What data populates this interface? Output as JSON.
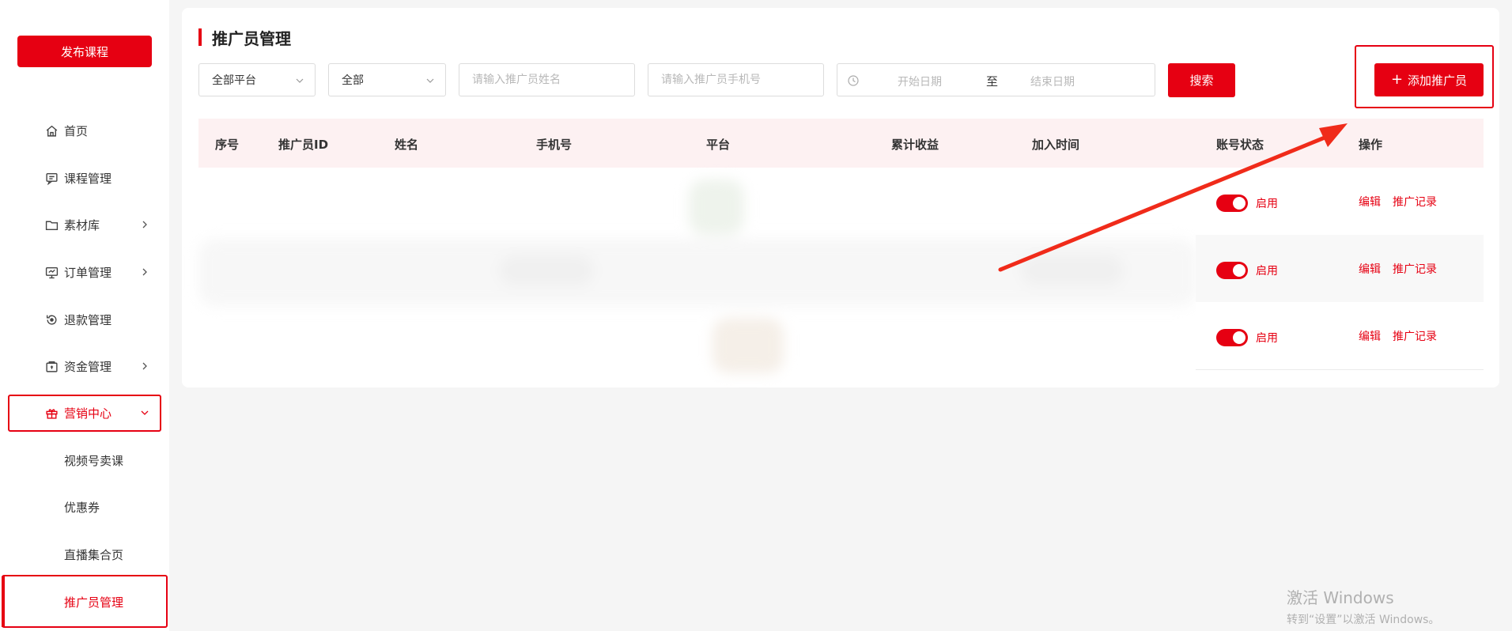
{
  "sidebar": {
    "publish_label": "发布课程",
    "items": [
      {
        "label": "首页",
        "icon": "home-icon"
      },
      {
        "label": "课程管理",
        "icon": "chat-icon"
      },
      {
        "label": "素材库",
        "icon": "folder-icon"
      },
      {
        "label": "订单管理",
        "icon": "monitor-icon"
      },
      {
        "label": "退款管理",
        "icon": "refund-icon"
      },
      {
        "label": "资金管理",
        "icon": "wallet-icon"
      },
      {
        "label": "营销中心",
        "icon": "gift-icon"
      }
    ],
    "sub_items": [
      {
        "label": "视频号卖课"
      },
      {
        "label": "优惠券"
      },
      {
        "label": "直播集合页"
      },
      {
        "label": "推广员管理"
      }
    ]
  },
  "page": {
    "title": "推广员管理"
  },
  "filters": {
    "platform": "全部平台",
    "scope": "全部",
    "name_placeholder": "请输入推广员姓名",
    "phone_placeholder": "请输入推广员手机号",
    "start_date_placeholder": "开始日期",
    "date_separator": "至",
    "end_date_placeholder": "结束日期",
    "search_label": "搜索",
    "add_label": "添加推广员",
    "add_icon": "plus-icon"
  },
  "table": {
    "columns": [
      "序号",
      "推广员ID",
      "姓名",
      "手机号",
      "平台",
      "累计收益",
      "加入时间",
      "账号状态",
      "操作"
    ],
    "rows": [
      {
        "status": "启用",
        "edit": "编辑",
        "record": "推广记录"
      },
      {
        "status": "启用",
        "edit": "编辑",
        "record": "推广记录"
      },
      {
        "status": "启用",
        "edit": "编辑",
        "record": "推广记录"
      }
    ]
  },
  "watermark": {
    "line1": "激活 Windows",
    "line2": "转到“设置”以激活 Windows。"
  },
  "colors": {
    "accent": "#e60012",
    "header_bg": "#fdf1f2"
  }
}
